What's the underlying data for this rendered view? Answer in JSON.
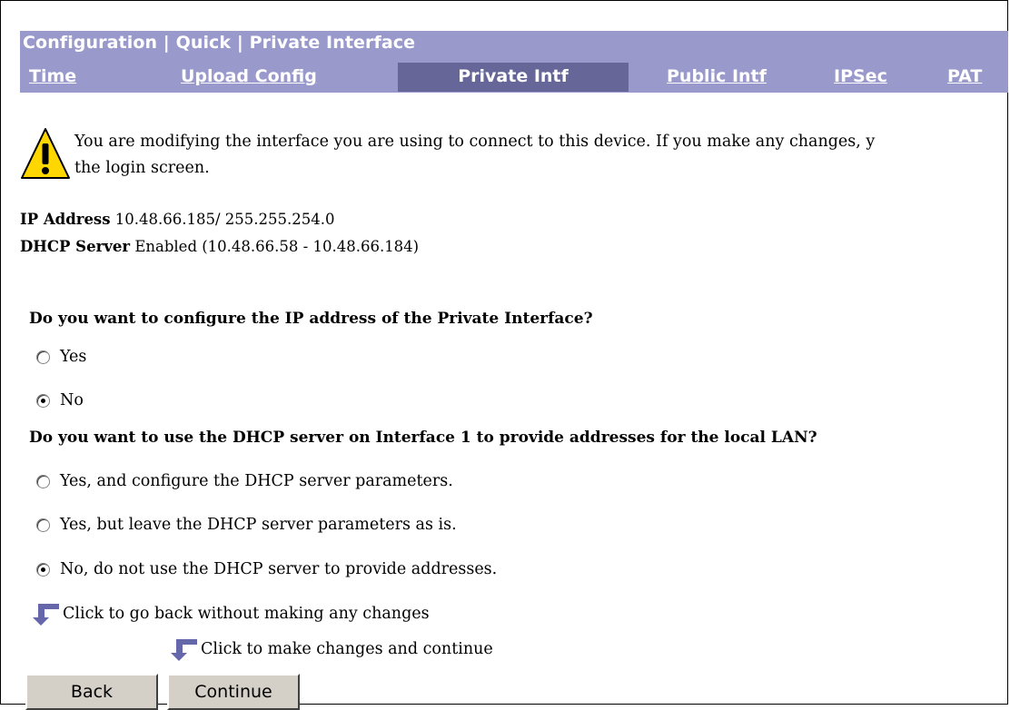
{
  "header": {
    "breadcrumb": "Configuration | Quick | Private Interface",
    "tabs": [
      {
        "label": "Time",
        "active": false
      },
      {
        "label": "Upload Config",
        "active": false
      },
      {
        "label": "Private Intf",
        "active": true
      },
      {
        "label": "Public Intf",
        "active": false
      },
      {
        "label": "IPSec",
        "active": false
      },
      {
        "label": "PAT",
        "active": false
      }
    ],
    "colors": {
      "bar": "#9999cc",
      "active_tab": "#666699",
      "text": "#ffffff"
    }
  },
  "warning": {
    "icon": "warning-triangle-icon",
    "line1": "You are modifying the interface you are using to connect to this device. If you make any changes, y",
    "line2": "the login screen."
  },
  "info": {
    "ip_label": "IP Address",
    "ip_value": "10.48.66.185/ 255.255.254.0",
    "dhcp_label": "DHCP Server",
    "dhcp_value": "Enabled (10.48.66.58 - 10.48.66.184)"
  },
  "question_ip": {
    "text": "Do you want to configure the IP address of the Private Interface?",
    "options": [
      {
        "label": "Yes",
        "checked": false
      },
      {
        "label": "No",
        "checked": true
      }
    ]
  },
  "question_dhcp": {
    "text": "Do you want to use the DHCP server on Interface 1 to provide addresses for the local LAN?",
    "options": [
      {
        "label": "Yes, and configure the DHCP server parameters.",
        "checked": false
      },
      {
        "label": "Yes, but leave the DHCP server parameters as is.",
        "checked": false
      },
      {
        "label": "No, do not use the DHCP server to provide addresses.",
        "checked": true
      }
    ]
  },
  "hints": {
    "back": "Click to go back without making any changes",
    "continue": "Click to make changes and continue",
    "icon": "down-arrow-icon"
  },
  "buttons": {
    "back": "Back",
    "continue": "Continue"
  }
}
